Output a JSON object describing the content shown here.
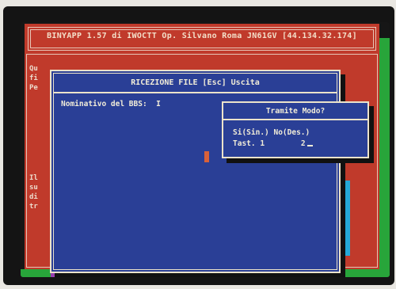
{
  "app": {
    "title": "BINYAPP 1.57 di IWOCTT Op. Silvano Roma JN61GV [44.134.32.174]"
  },
  "background_window": {
    "lines": [
      "Qu",
      "fi",
      "Pe"
    ],
    "lines2": [
      "Il",
      "su",
      "di",
      "tr"
    ]
  },
  "receive_window": {
    "title": "RICEZIONE FILE [Esc] Uscita",
    "prompt_label": "Nominativo del BBS:",
    "prompt_value": "I"
  },
  "mode_dialog": {
    "title": "Tramite Modo?",
    "options_line": "Si(Sin.) No(Des.)",
    "keys_label": "Tast.",
    "key_1": "1",
    "key_2": "2"
  },
  "colors": {
    "red_panel": "#c03a2b",
    "blue_window": "#2a3f96",
    "green_bar": "#28a53a",
    "purple_bar": "#9a3fb0",
    "cyan_strip": "#24a9d8"
  }
}
